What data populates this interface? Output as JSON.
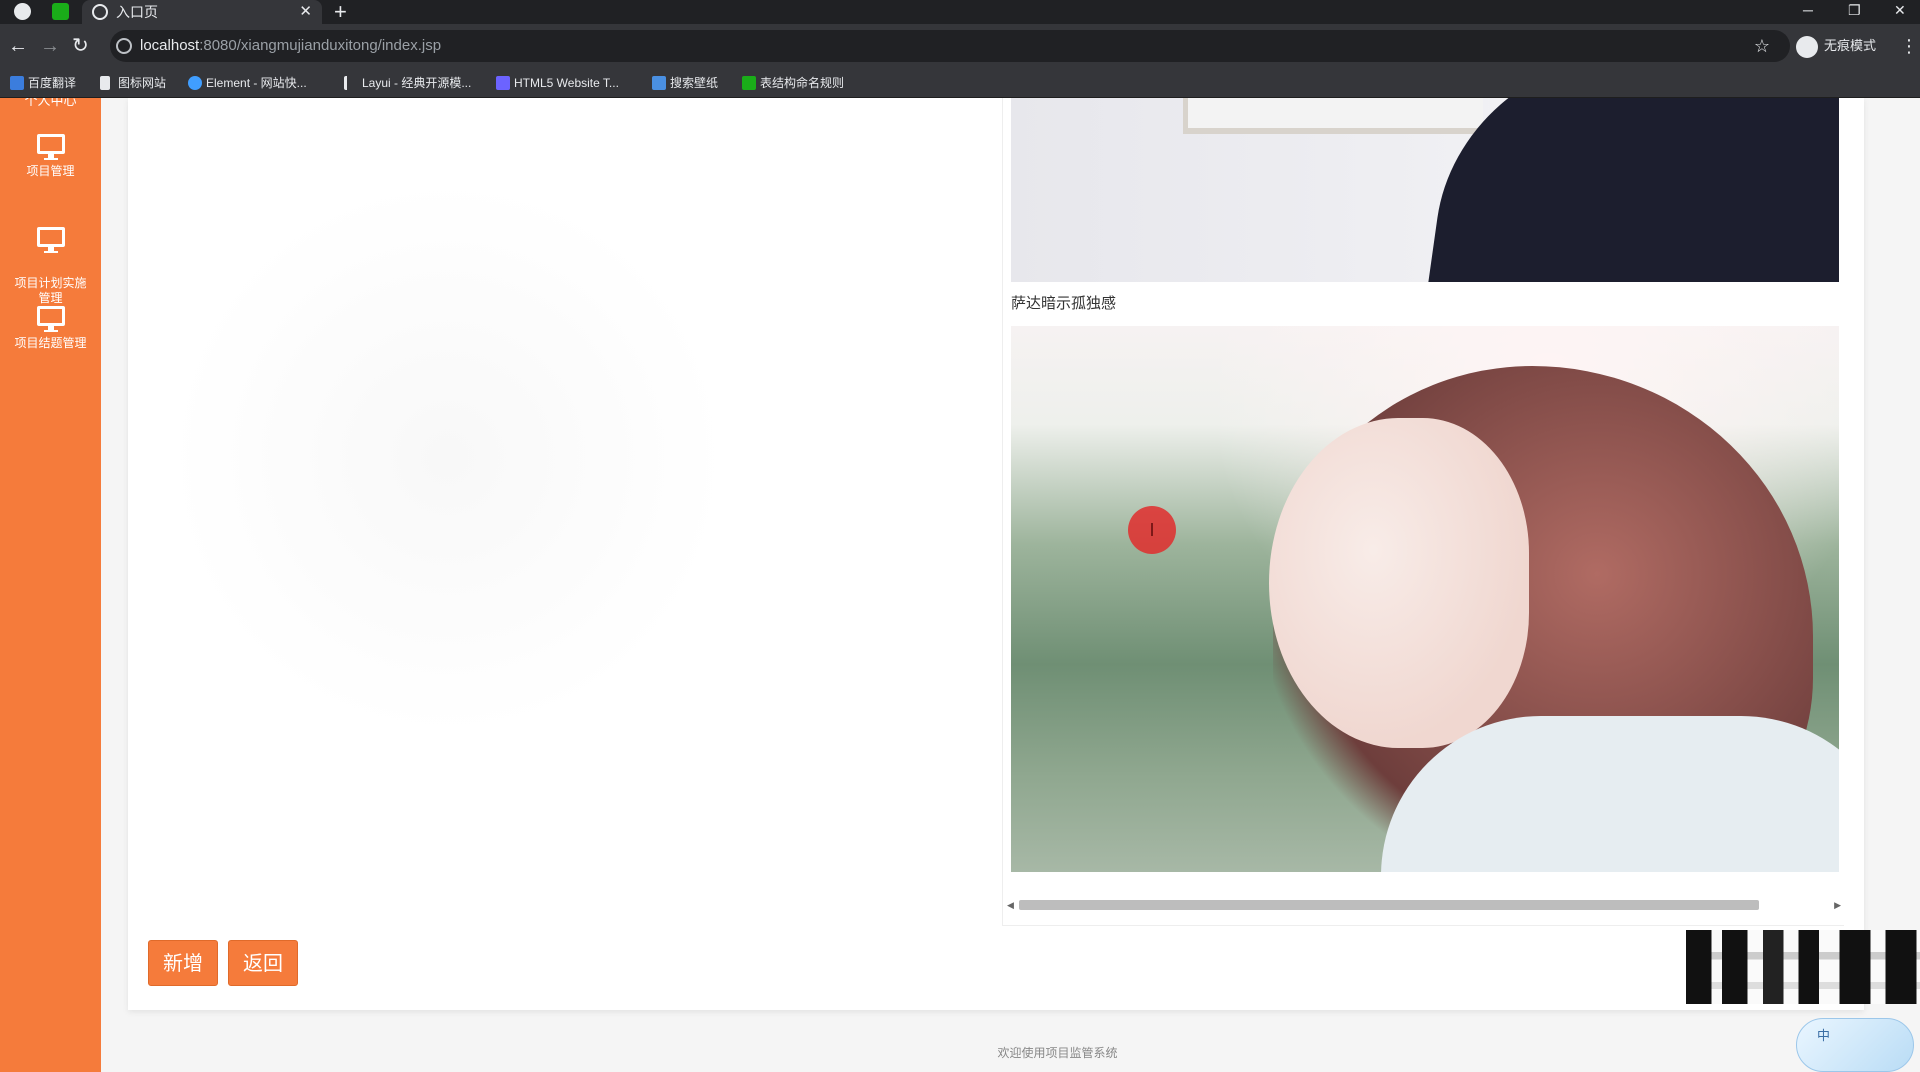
{
  "browser": {
    "tab_title": "入口页",
    "new_tab": "+",
    "close": "✕",
    "url_host": "localhost",
    "url_path": ":8080/xiangmujianduxitong/index.jsp",
    "incognito_label": "无痕模式",
    "window_controls": [
      "─",
      "❐",
      "✕"
    ]
  },
  "bookmarks": [
    {
      "label": "百度翻译",
      "color": "#3b7ddd"
    },
    {
      "label": "图标网站",
      "color": "#e8eaed"
    },
    {
      "label": "Element - 网站快...",
      "color": "#409eff"
    },
    {
      "label": "Layui - 经典开源模...",
      "color": "#e8eaed"
    },
    {
      "label": "HTML5 Website T...",
      "color": "#6c63ff"
    },
    {
      "label": "搜索壁纸",
      "color": "#4a90e2"
    },
    {
      "label": "表结构命名规则",
      "color": "#1aad19"
    }
  ],
  "sidebar": {
    "top_label": "个人中心",
    "items": [
      {
        "label": "项目管理"
      },
      {
        "label": "项目计划实施\n管理"
      },
      {
        "label": "项目结题管理"
      }
    ]
  },
  "content": {
    "caption": "萨达暗示孤独感",
    "add_button": "新增",
    "back_button": "返回",
    "to_top": "︿",
    "footer": "欢迎使用项目监管系统",
    "ime_label": "中",
    "cursor_glyph": "I"
  },
  "colors": {
    "sidebar": "#f57b3b",
    "button": "#f57b3b"
  }
}
